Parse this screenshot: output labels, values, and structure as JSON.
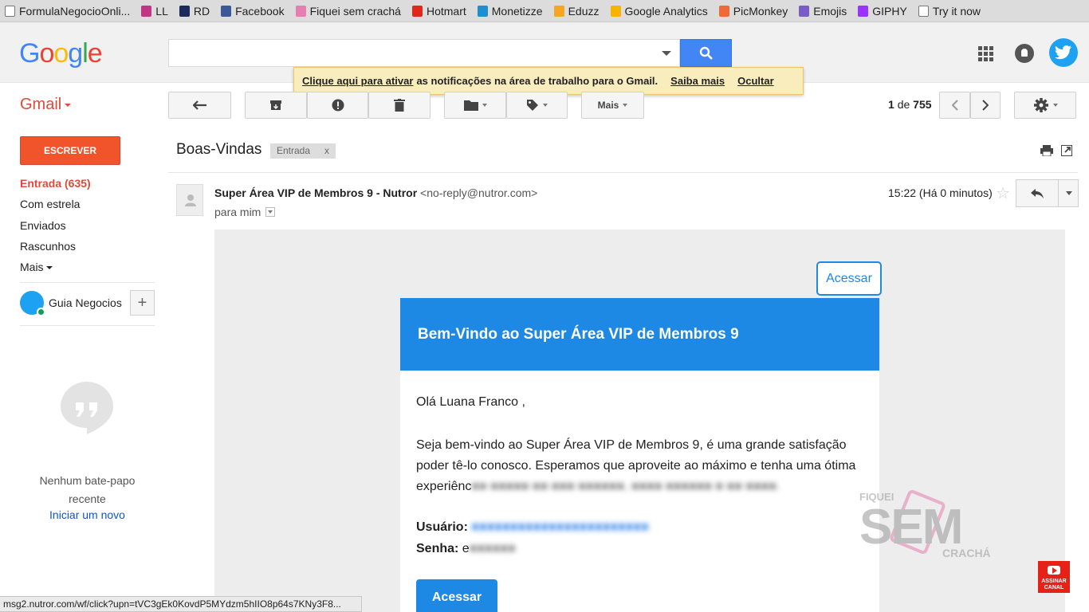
{
  "bookmarks": [
    {
      "label": "FormulaNegocioOnli...",
      "icon": "page-icon",
      "color": "#ffffff"
    },
    {
      "label": "LL",
      "icon": "instagram-icon",
      "color": "#c13584"
    },
    {
      "label": "RD",
      "icon": "rd-icon",
      "color": "#1a2b5c"
    },
    {
      "label": "Facebook",
      "icon": "facebook-icon",
      "color": "#3b5998"
    },
    {
      "label": "Fiquei sem crachá",
      "icon": "tag-icon",
      "color": "#e57fb0"
    },
    {
      "label": "Hotmart",
      "icon": "hotmart-icon",
      "color": "#e0271a"
    },
    {
      "label": "Monetizze",
      "icon": "monetizze-icon",
      "color": "#1f8ecf"
    },
    {
      "label": "Eduzz",
      "icon": "eduzz-icon",
      "color": "#f5a623"
    },
    {
      "label": "Google Analytics",
      "icon": "analytics-icon",
      "color": "#f4b400"
    },
    {
      "label": "PicMonkey",
      "icon": "picmonkey-icon",
      "color": "#ee6a39"
    },
    {
      "label": "Emojis",
      "icon": "emoji-icon",
      "color": "#7a5cc7"
    },
    {
      "label": "GIPHY",
      "icon": "giphy-icon",
      "color": "#9933ff"
    },
    {
      "label": "Try it now",
      "icon": "page-icon",
      "color": "#ffffff"
    }
  ],
  "header": {
    "logo": [
      "G",
      "o",
      "o",
      "g",
      "l",
      "e"
    ],
    "search_value": ""
  },
  "notification": {
    "activate_link": "Clique aqui para ativar",
    "message": "as notificações na área de trabalho para o Gmail.",
    "learn_more": "Saiba mais",
    "hide": "Ocultar"
  },
  "sidebar": {
    "app_label": "Gmail",
    "compose": "ESCREVER",
    "items": [
      {
        "label": "Entrada (635)"
      },
      {
        "label": "Com estrela"
      },
      {
        "label": "Enviados"
      },
      {
        "label": "Rascunhos"
      },
      {
        "label": "Mais"
      }
    ],
    "hangout_user": "Guia Negocios",
    "no_chat": "Nenhum bate-papo recente",
    "start_new": "Iniciar um novo"
  },
  "toolbar": {
    "more_label": "Mais",
    "pager_range": "1",
    "pager_of": "de",
    "pager_total": "755"
  },
  "email": {
    "subject": "Boas-Vindas",
    "label_chip": "Entrada",
    "label_remove": "x",
    "sender_name": "Super Área VIP de Membros 9 - Nutror",
    "sender_email": "<no-reply@nutror.com>",
    "to": "para mim",
    "time": "15:22 (Há 0 minutos)",
    "top_button": "Acessar",
    "card_title": "Bem-Vindo ao Super Área VIP de Membros 9",
    "greeting": "Olá Luana Franco ,",
    "body_visible": "Seja bem-vindo ao Super Área VIP de Membros 9, é uma grande satisfação poder tê-lo conosco. Esperamos que aproveite ao máximo e tenha uma ótima experiênc",
    "user_label": "Usuário:",
    "password_label": "Senha:",
    "password_prefix": "e",
    "bottom_button": "Acessar"
  },
  "watermark": {
    "line1": "FIQUEI",
    "line2": "SEM",
    "line3": "CRACHÁ"
  },
  "youtube_badge": "ASSINAR CANAL",
  "status_url": "msg2.nutror.com/wf/click?upn=tVC3gEk0KovdP5MYdzm5hIIO8p64s7KNy3F8...",
  "colors": {
    "gmail_red": "#dd4b39",
    "compose": "#f1542b",
    "google_blue": "#4285f4",
    "email_blue": "#1e88e5",
    "banner": "#f9edbe"
  }
}
